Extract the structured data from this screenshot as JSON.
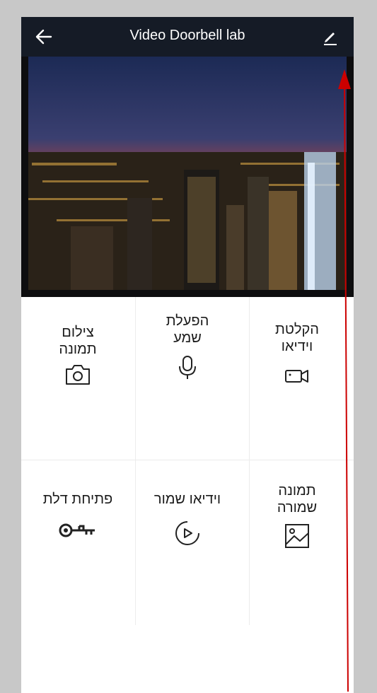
{
  "header": {
    "title": "Video Doorbell lab",
    "back_icon": "arrow-left-icon",
    "edit_icon": "pencil-icon"
  },
  "actions": [
    {
      "label": "הקלטת\nוידיאו",
      "icon": "video-camera-icon"
    },
    {
      "label": "הפעלת\nשמע",
      "icon": "microphone-icon"
    },
    {
      "label": "צילום\nתמונה",
      "icon": "camera-icon"
    },
    {
      "label": "תמונה\nשמורה",
      "icon": "image-icon"
    },
    {
      "label": "וידיאו שמור",
      "icon": "play-circle-icon"
    },
    {
      "label": "פתיחת דלת",
      "icon": "key-icon"
    }
  ],
  "colors": {
    "header_bg": "#151b26",
    "annotation_arrow": "#cc0000"
  }
}
